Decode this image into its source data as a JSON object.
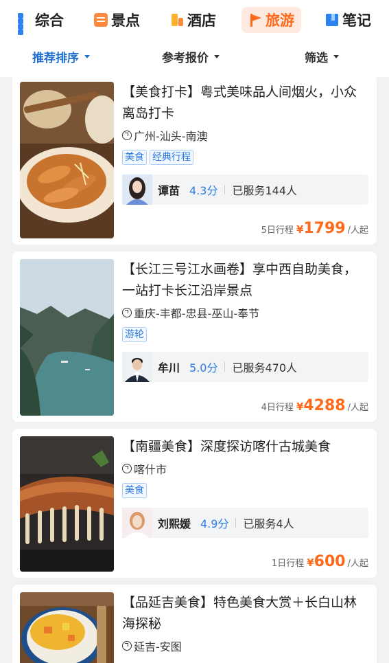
{
  "category_tabs": [
    {
      "label": "综合",
      "icon": "grid-icon"
    },
    {
      "label": "景点",
      "icon": "ticket-icon"
    },
    {
      "label": "酒店",
      "icon": "hotel-icon"
    },
    {
      "label": "旅游",
      "icon": "flag-icon",
      "active": true
    },
    {
      "label": "笔记",
      "icon": "note-icon"
    }
  ],
  "sort_bar": [
    {
      "label": "推荐排序",
      "active": true
    },
    {
      "label": "参考报价"
    },
    {
      "label": "筛选"
    }
  ],
  "colors": {
    "accent": "#ff6a1a",
    "link_blue": "#2b7be0",
    "active_sort": "#1f6fcf"
  },
  "cards": [
    {
      "title": "【美食打卡】粤式美味品人间烟火，小众离岛打卡",
      "route": "广州-汕头-南澳",
      "tags": [
        "美食",
        "经典行程"
      ],
      "guide": {
        "name": "谭苗",
        "score": "4.3分",
        "served": "已服务144人"
      },
      "days": "5日行程",
      "currency": "¥",
      "price": "1799",
      "per": "/人起"
    },
    {
      "title": "【长江三号江水画卷】享中西自助美食，一站打卡长江沿岸景点",
      "route": "重庆-丰都-忠县-巫山-奉节",
      "tags": [
        "游轮"
      ],
      "guide": {
        "name": "牟川",
        "score": "5.0分",
        "served": "已服务470人"
      },
      "days": "4日行程",
      "currency": "¥",
      "price": "4288",
      "per": "/人起"
    },
    {
      "title": "【南疆美食】深度探访喀什古城美食",
      "route": "喀什市",
      "tags": [
        "美食"
      ],
      "guide": {
        "name": "刘熙媛",
        "score": "4.9分",
        "served": "已服务4人"
      },
      "days": "1日行程",
      "currency": "¥",
      "price": "600",
      "per": "/人起"
    },
    {
      "title": "【品延吉美食】特色美食大赏＋长白山林海探秘",
      "route": "延吉-安图",
      "tags": []
    }
  ]
}
